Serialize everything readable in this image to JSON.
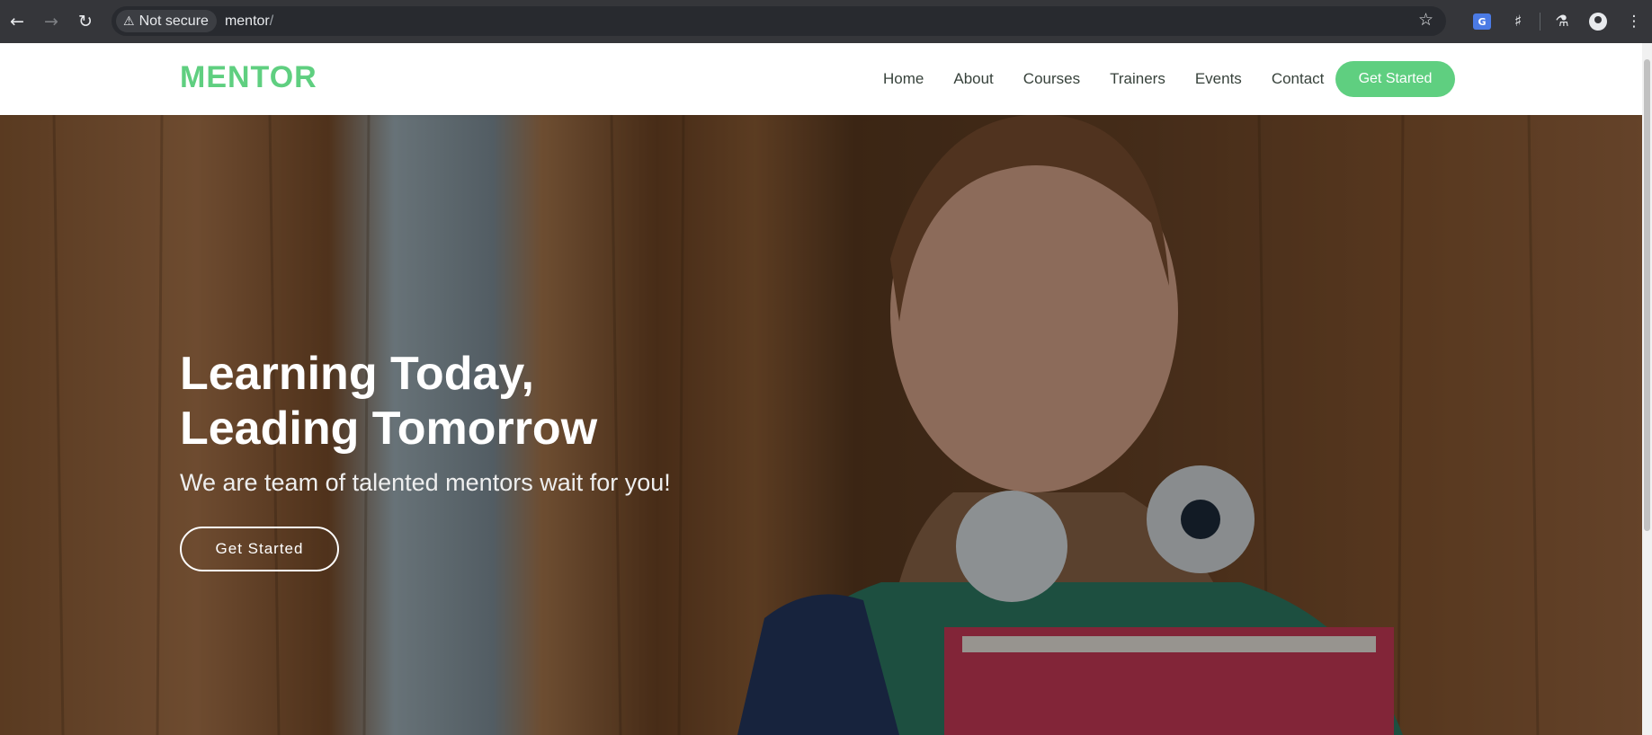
{
  "browser": {
    "security_label": "Not secure",
    "url_host": "mentor",
    "url_path": "/",
    "icons": [
      "back-icon",
      "forward-icon",
      "reload-icon",
      "warning-icon",
      "star-icon",
      "translate-icon",
      "extensions-icon",
      "labs-icon",
      "profile-icon",
      "menu-icon"
    ],
    "translate_badge": "G"
  },
  "header": {
    "logo": "MENTOR",
    "nav": [
      "Home",
      "About",
      "Courses",
      "Trainers",
      "Events",
      "Contact"
    ],
    "cta": "Get Started"
  },
  "hero": {
    "title_line1": "Learning Today,",
    "title_line2": "Leading Tomorrow",
    "subtitle": "We are team of talented mentors wait for you!",
    "button": "Get Started"
  },
  "colors": {
    "accent": "#5fcf80",
    "nav_text": "#37423b",
    "chrome_bg": "#35363a"
  }
}
